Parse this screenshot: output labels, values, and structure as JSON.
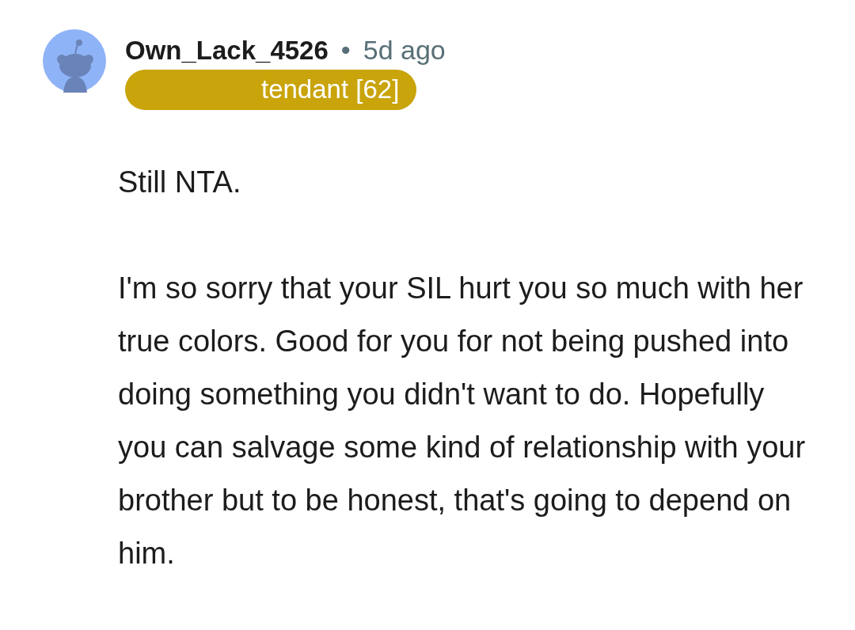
{
  "comment": {
    "author": "Own_Lack_4526",
    "separator": "•",
    "age": "5d ago",
    "flair": "tendant [62]",
    "paragraphs": [
      "Still NTA.",
      "I'm so sorry that your SIL hurt you so much with her true colors. Good for you for not being pushed into doing something you didn't want to do. Hopefully you can salvage some kind of relationship with your brother but to be honest, that's going to depend on him."
    ]
  }
}
